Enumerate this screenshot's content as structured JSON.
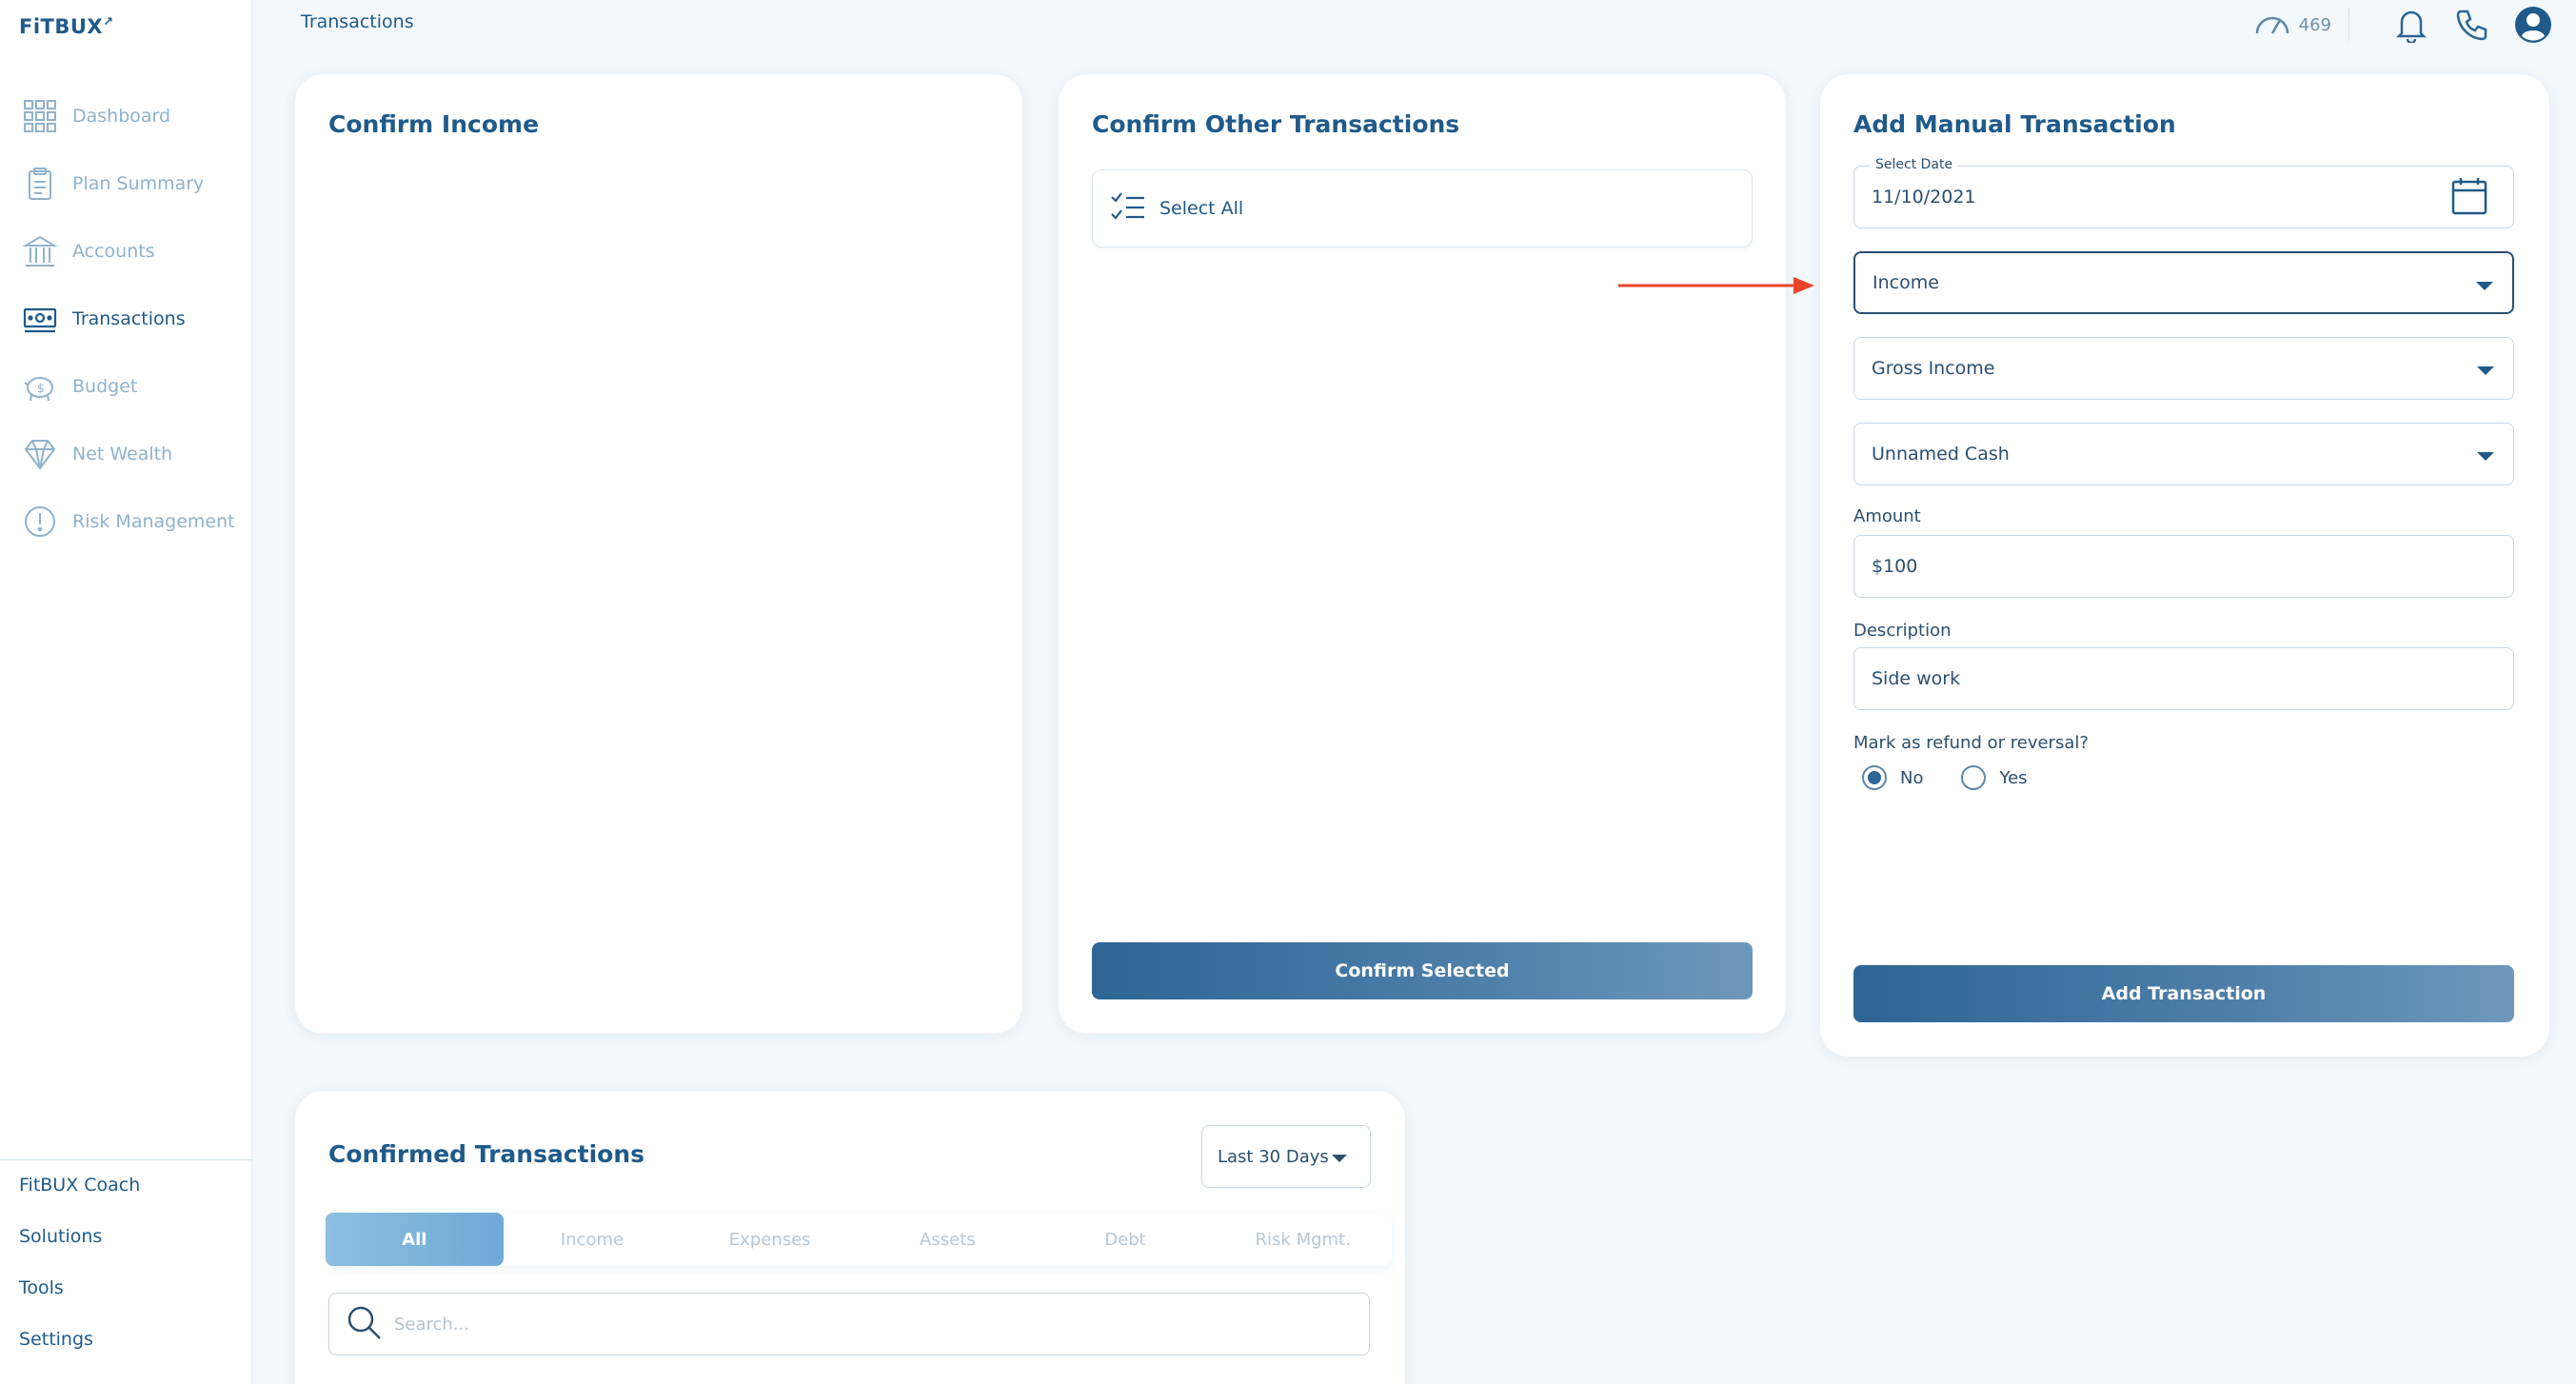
{
  "brand": {
    "name": "FiTBUX"
  },
  "sidebar": {
    "items": [
      {
        "label": "Dashboard",
        "icon": "grid-icon"
      },
      {
        "label": "Plan Summary",
        "icon": "clipboard-icon"
      },
      {
        "label": "Accounts",
        "icon": "bank-icon"
      },
      {
        "label": "Transactions",
        "icon": "money-icon",
        "active": true
      },
      {
        "label": "Budget",
        "icon": "piggy-bank-icon"
      },
      {
        "label": "Net Wealth",
        "icon": "diamond-icon"
      },
      {
        "label": "Risk Management",
        "icon": "alert-circle-icon"
      }
    ],
    "bottom": [
      "FitBUX Coach",
      "Solutions",
      "Tools",
      "Settings"
    ]
  },
  "header": {
    "breadcrumb": "Transactions",
    "score": "469"
  },
  "confirm_income": {
    "title": "Confirm Income"
  },
  "confirm_other": {
    "title": "Confirm Other Transactions",
    "select_all": "Select All",
    "button": "Confirm Selected"
  },
  "manual": {
    "title": "Add Manual Transaction",
    "date_label": "Select Date",
    "date_value": "11/10/2021",
    "type": "Income",
    "category": "Gross Income",
    "account": "Unnamed Cash",
    "amount_label": "Amount",
    "amount_value": "$100",
    "description_label": "Description",
    "description_value": "Side work",
    "refund_label": "Mark as refund or reversal?",
    "refund_options": [
      "No",
      "Yes"
    ],
    "refund_selected": "No",
    "button": "Add Transaction"
  },
  "confirmed": {
    "title": "Confirmed Transactions",
    "range": "Last 30 Days",
    "tabs": [
      "All",
      "Income",
      "Expenses",
      "Assets",
      "Debt",
      "Risk Mgmt."
    ],
    "active_tab": "All",
    "search_placeholder": "Search..."
  },
  "colors": {
    "primary": "#1f5a8a",
    "accent_arrow": "#e8452c",
    "tab_active": "#7ab4dc"
  }
}
